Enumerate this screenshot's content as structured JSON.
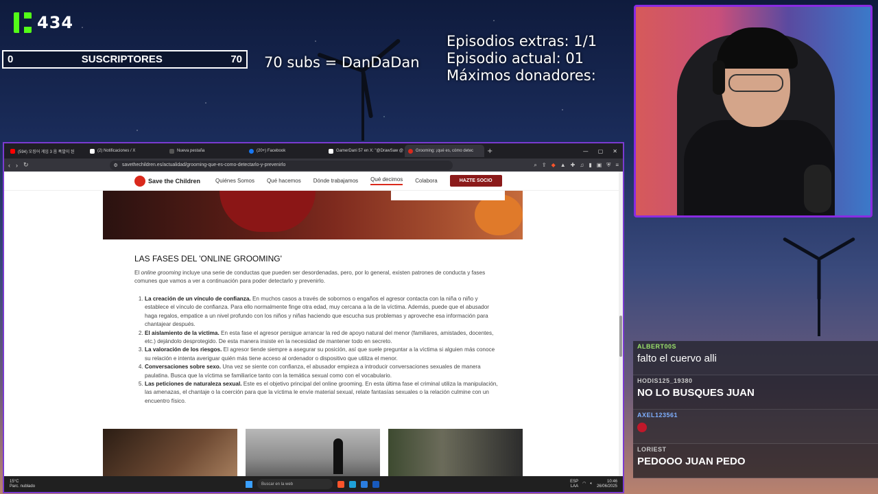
{
  "overlay": {
    "kick_count": "434",
    "sub_goal": {
      "current": "0",
      "label": "SUSCRIPTORES",
      "target": "70",
      "progress": 0.0
    },
    "sub_goal_reward": "70 subs = DanDaDan",
    "episodes": [
      "Episodios extras: 1/1",
      "Episodio actual: 01",
      "Máximos donadores:"
    ]
  },
  "browser": {
    "tabs": [
      {
        "label": "(594) 오징어 게임 3 음 폭발이 된",
        "icon_color": "#ff0000",
        "active": false
      },
      {
        "label": "(2) Notificaciones / X",
        "icon_color": "#ffffff",
        "active": false
      },
      {
        "label": "Nueva pestaña",
        "icon_color": "#555555",
        "active": false
      },
      {
        "label": "(20+) Facebook",
        "icon_color": "#1877f2",
        "active": false
      },
      {
        "label": "GamerDani 57 en X: \"@DrawSaw @",
        "icon_color": "#ffffff",
        "active": false
      },
      {
        "label": "Grooming: ¡qué es, cómo detec",
        "icon_color": "#da291c",
        "active": true
      }
    ],
    "new_tab": "+",
    "url": "savethechildren.es/actualidad/grooming-que-es-como-detectarlo-y-prevenirlo"
  },
  "site": {
    "logo": "Save the Children",
    "nav": [
      "Quiénes Somos",
      "Qué hacemos",
      "Dónde trabajamos",
      "Qué decimos",
      "Colabora"
    ],
    "active_nav": "Qué decimos",
    "cta": "HAZTE SOCIO"
  },
  "article": {
    "heading": "LAS FASES DEL 'ONLINE GROOMING'",
    "intro_prefix": "El ",
    "intro_em": "online grooming",
    "intro_rest": " incluye una serie de conductas que pueden ser desordenadas, pero, por lo general, existen patrones de conducta y fases comunes que vamos a ver a continuación para poder detectarlo y prevenirlo.",
    "items": [
      {
        "title": "La creación de un vínculo de confianza.",
        "text": " En muchos casos a través de sobornos o engaños el agresor contacta con la niña o niño y establece el vínculo de confianza. Para ello normalmente finge otra edad, muy cercana a la de la víctima. Además, puede que el abusador haga regalos, empatice a un nivel profundo con los niños y niñas haciendo que escucha sus problemas y aproveche esa información para chantajear después."
      },
      {
        "title": "El aislamiento de la víctima.",
        "text": " En esta fase el agresor persigue arrancar la red de apoyo natural del menor (familiares, amistades, docentes, etc.) dejándolo desprotegido. De esta manera insiste en la necesidad de mantener todo en secreto."
      },
      {
        "title": "La valoración de los riesgos.",
        "text": " El agresor tiende siempre a asegurar su posición, así que suele preguntar a la víctima si alguien más conoce su relación e intenta averiguar quién más tiene acceso al ordenador o dispositivo que utiliza el menor."
      },
      {
        "title": "Conversaciones sobre sexo.",
        "text": " Una vez se siente con confianza, el abusador empieza a introducir conversaciones sexuales de manera paulatina. Busca que la víctima se familiarice tanto con la temática sexual como con el vocabulario."
      },
      {
        "title": "Las peticiones de naturaleza sexual.",
        "text": " Este es el objetivo principal del online grooming. En esta última fase el criminal utiliza la manipulación, las amenazas, el chantaje o la coerción para que la víctima le envíe material sexual, relate fantasías sexuales o la relación culmine con un encuentro físico."
      }
    ]
  },
  "taskbar": {
    "temp": "15°C",
    "weather": "Parc. nublado",
    "search_placeholder": "Buscar en la web",
    "lang": "ESP",
    "region": "LAA",
    "time": "10:46",
    "date": "26/06/2025"
  },
  "chat": [
    {
      "user": "ALBERT00S",
      "color": "#9be36a",
      "text": "falto el cuervo alli",
      "bold": false,
      "emote": false
    },
    {
      "user": "HODIS125_19380",
      "color": "#c9c9c9",
      "text": "NO LO BUSQUES JUAN",
      "bold": true,
      "emote": false
    },
    {
      "user": "AXEL123561",
      "color": "#7fb0ff",
      "text": "",
      "bold": false,
      "emote": true
    },
    {
      "user": "LORIEST",
      "color": "#c9c9c9",
      "text": "PEDOOO JUAN PEDO",
      "bold": true,
      "emote": false
    }
  ],
  "colors": {
    "accent": "#7b3bd1",
    "kick_green": "#53fc18",
    "stc_red": "#da291c",
    "cta_bg": "#8b1a1a"
  }
}
